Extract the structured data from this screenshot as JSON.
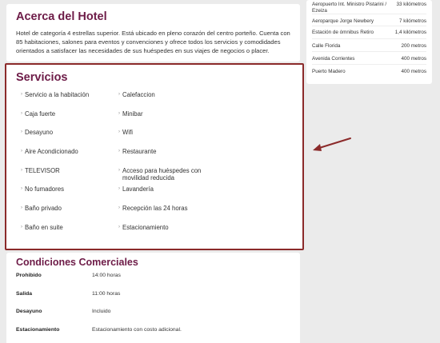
{
  "about": {
    "title": "Acerca del Hotel",
    "description": "Hotel de categoría 4 estrellas superior. Está ubicado en pleno corazón del centro porteño. Cuenta con 85 habitaciones, salones para eventos y convenciones y ofrece todos los servicios y comodidades orientados a satisfacer las necesidades de sus huéspedes en sus viajes de negocios o placer."
  },
  "distances": [
    {
      "place": "Aeropuerto Int. Ministro Pistarini / Ezeiza",
      "value": "33 kilómetros"
    },
    {
      "place": "Aeroparque Jorge Newbery",
      "value": "7 kilómetros"
    },
    {
      "place": "Estación de ómnibus Retiro",
      "value": "1,4 kilómetros"
    },
    {
      "place": "Calle Florida",
      "value": "200 metros"
    },
    {
      "place": "Avenida Corrientes",
      "value": "400 metros"
    },
    {
      "place": "Puerto Madero",
      "value": "400 metros"
    }
  ],
  "services": {
    "title": "Servicios",
    "items": [
      "Servicio a la habitación",
      "Calefaccion",
      "Caja fuerte",
      "Minibar",
      "Desayuno",
      "Wifi",
      "Aire Acondicionado",
      "Restaurante",
      "TELEVISOR",
      "Acceso para huéspedes con movilidad reducida",
      "No fumadores",
      "Lavandería",
      "Baño privado",
      "Recepción las 24 horas",
      "Baño en suite",
      "Estacionamiento"
    ]
  },
  "conditions": {
    "title": "Condiciones Comerciales",
    "rows": [
      {
        "key": "Prohibido",
        "value": "14:00 horas"
      },
      {
        "key": "Salida",
        "value": "11:00 horas"
      },
      {
        "key": "Desayuno",
        "value": "Incluido"
      },
      {
        "key": "Estacionamiento",
        "value": "Estacionamiento con costo adicional."
      }
    ]
  },
  "colors": {
    "heading": "#6d1b47",
    "highlight_border": "#8b2a2a",
    "arrow": "#8b2a2a"
  }
}
